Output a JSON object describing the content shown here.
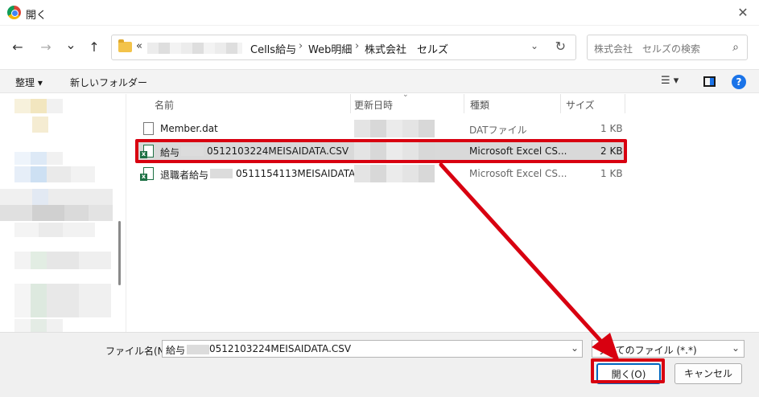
{
  "window": {
    "title": "開く"
  },
  "nav": {
    "back": "←",
    "forward": "→",
    "recent": "⌄",
    "up": "↑"
  },
  "address": {
    "prefix": "«",
    "crumbs": [
      "Cells給与",
      "Web明細",
      "株式会社　セルズ"
    ],
    "separator": "›"
  },
  "search": {
    "placeholder": "株式会社　セルズの検索"
  },
  "toolbar": {
    "organize": "整理 ▾",
    "new_folder": "新しいフォルダー",
    "view_icon": "☰ ▾",
    "help": "?"
  },
  "columns": {
    "name": "名前",
    "date": "更新日時",
    "type": "種類",
    "size": "サイズ"
  },
  "files": [
    {
      "name": "Member.dat",
      "type": "DATファイル",
      "size": "1 KB",
      "icon": "document-icon",
      "selected": false
    },
    {
      "name_prefix": "給与",
      "name_suffix": "0512103224MEISAIDATA.CSV",
      "type": "Microsoft Excel CS...",
      "size": "2 KB",
      "icon": "excel-csv-icon",
      "selected": true
    },
    {
      "name_prefix": "退職者給与",
      "name_suffix": "0511154113MEISAIDATA....",
      "type": "Microsoft Excel CS...",
      "size": "1 KB",
      "icon": "excel-csv-icon",
      "selected": false
    }
  ],
  "footer": {
    "filename_label": "ファイル名(N):",
    "filename_prefix": "給与",
    "filename_suffix": "0512103224MEISAIDATA.CSV",
    "filetype": "すべてのファイル (*.*)",
    "open_button": "開く(O)",
    "cancel_button": "キャンセル"
  },
  "colors": {
    "highlight": "#d80010",
    "selection": "#d9d9d9",
    "accent": "#0067c0"
  }
}
